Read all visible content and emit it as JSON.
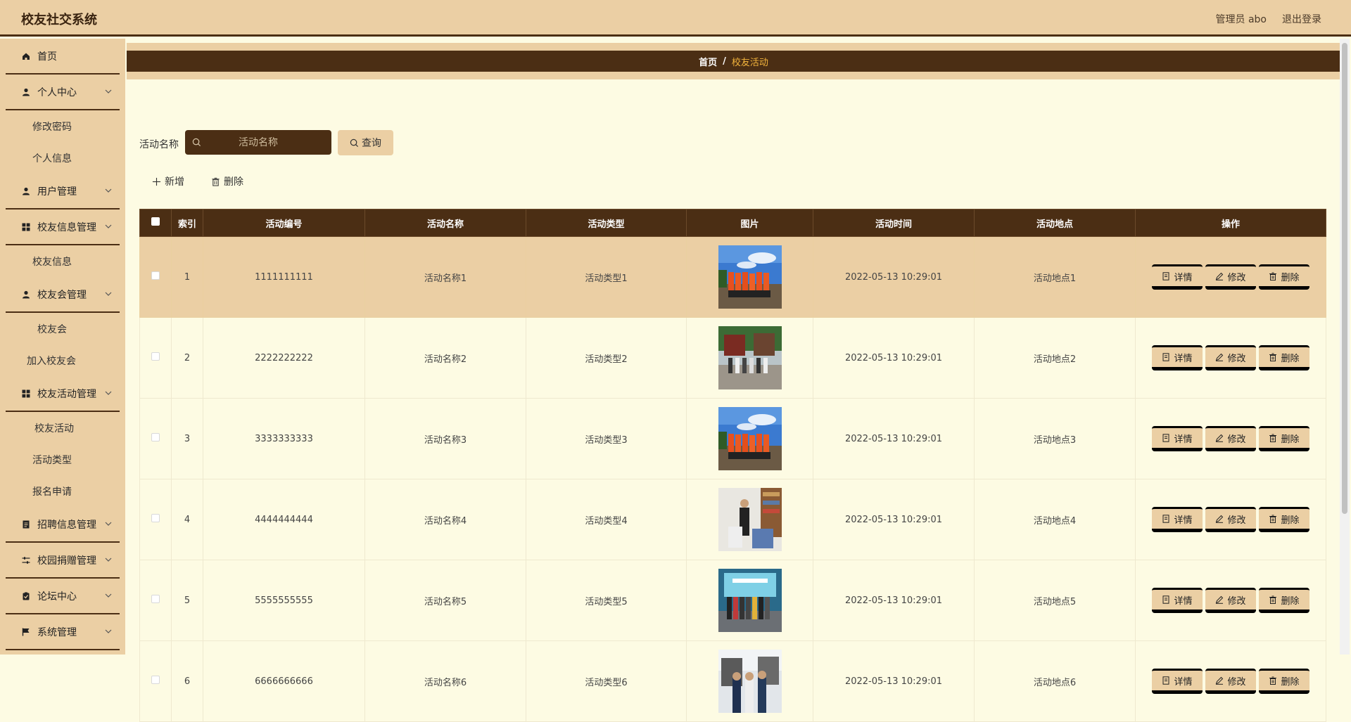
{
  "header": {
    "title": "校友社交系统",
    "user": "管理员 abo",
    "logout": "退出登录"
  },
  "sidebar": [
    {
      "type": "menu",
      "name": "home",
      "label": "首页",
      "icon": "home-icon",
      "chevron": false
    },
    {
      "type": "menu",
      "name": "personal-center",
      "label": "个人中心",
      "icon": "user-icon",
      "chevron": true
    },
    {
      "type": "sub",
      "name": "change-password",
      "label": "修改密码",
      "indent": 46
    },
    {
      "type": "sub",
      "name": "personal-info",
      "label": "个人信息",
      "indent": 46
    },
    {
      "type": "menu",
      "name": "user-management",
      "label": "用户管理",
      "icon": "user-icon",
      "chevron": true
    },
    {
      "type": "menu",
      "name": "alumni-info-management",
      "label": "校友信息管理",
      "icon": "grid-icon",
      "chevron": true
    },
    {
      "type": "sub",
      "name": "alumni-info",
      "label": "校友信息",
      "indent": 46
    },
    {
      "type": "menu",
      "name": "alumni-association-management",
      "label": "校友会管理",
      "icon": "user-icon",
      "chevron": true
    },
    {
      "type": "sub",
      "name": "alumni-association",
      "label": "校友会",
      "indent": 53
    },
    {
      "type": "sub",
      "name": "join-association",
      "label": "加入校友会",
      "indent": 38
    },
    {
      "type": "menu",
      "name": "alumni-activity-management",
      "label": "校友活动管理",
      "icon": "grid-icon",
      "chevron": true
    },
    {
      "type": "sub",
      "name": "alumni-activity",
      "label": "校友活动",
      "indent": 49
    },
    {
      "type": "sub",
      "name": "activity-type",
      "label": "活动类型",
      "indent": 46
    },
    {
      "type": "sub",
      "name": "registration",
      "label": "报名申请",
      "indent": 46
    },
    {
      "type": "menu",
      "name": "recruitment-management",
      "label": "招聘信息管理",
      "icon": "document-icon",
      "chevron": true
    },
    {
      "type": "menu",
      "name": "donation-management",
      "label": "校园捐赠管理",
      "icon": "sliders-icon",
      "chevron": true
    },
    {
      "type": "menu",
      "name": "forum-center",
      "label": "论坛中心",
      "icon": "clipboard-icon",
      "chevron": true
    },
    {
      "type": "menu",
      "name": "system-management",
      "label": "系统管理",
      "icon": "flag-icon",
      "chevron": true
    }
  ],
  "breadcrumb": {
    "home": "首页",
    "sep": "/",
    "current": "校友活动"
  },
  "search": {
    "label": "活动名称",
    "placeholder": "活动名称",
    "button": "查询"
  },
  "toolbar": {
    "add": "新增",
    "delete": "删除"
  },
  "table": {
    "headers": [
      "索引",
      "活动编号",
      "活动名称",
      "活动类型",
      "图片",
      "活动时间",
      "活动地点",
      "操作"
    ],
    "rows": [
      {
        "index": "1",
        "code": "1111111111",
        "name": "活动名称1",
        "type": "活动类型1",
        "time": "2022-05-13 10:29:01",
        "place": "活动地点1",
        "photo": "a"
      },
      {
        "index": "2",
        "code": "2222222222",
        "name": "活动名称2",
        "type": "活动类型2",
        "time": "2022-05-13 10:29:01",
        "place": "活动地点2",
        "photo": "b"
      },
      {
        "index": "3",
        "code": "3333333333",
        "name": "活动名称3",
        "type": "活动类型3",
        "time": "2022-05-13 10:29:01",
        "place": "活动地点3",
        "photo": "a"
      },
      {
        "index": "4",
        "code": "4444444444",
        "name": "活动名称4",
        "type": "活动类型4",
        "time": "2022-05-13 10:29:01",
        "place": "活动地点4",
        "photo": "c"
      },
      {
        "index": "5",
        "code": "5555555555",
        "name": "活动名称5",
        "type": "活动类型5",
        "time": "2022-05-13 10:29:01",
        "place": "活动地点5",
        "photo": "d"
      },
      {
        "index": "6",
        "code": "6666666666",
        "name": "活动名称6",
        "type": "活动类型6",
        "time": "2022-05-13 10:29:01",
        "place": "活动地点6",
        "photo": "e"
      }
    ],
    "actions": {
      "detail": "详情",
      "edit": "修改",
      "delete": "删除"
    }
  },
  "colors": {
    "primary": "#4b2e14",
    "beige": "#ebcfa4",
    "background": "#fdfbe3",
    "accent": "#f3b43c"
  }
}
